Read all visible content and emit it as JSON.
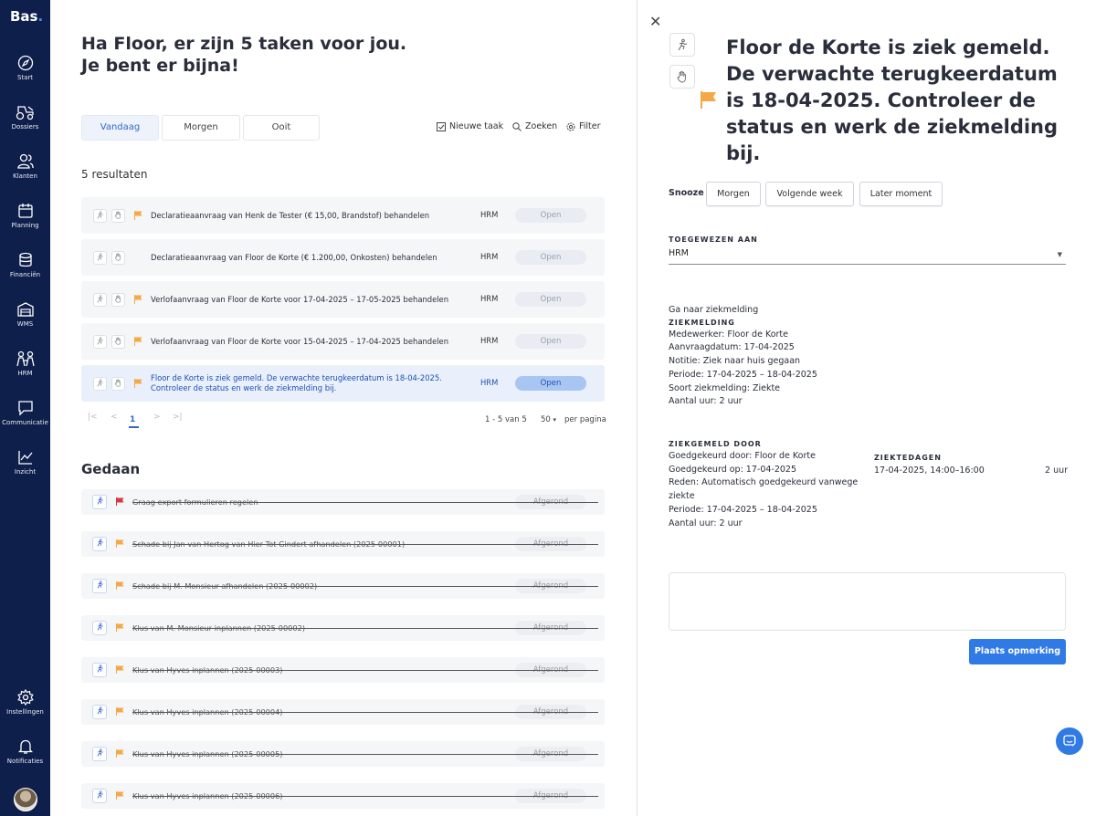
{
  "sidebar": {
    "logo": "Bas",
    "logo_dot": ".",
    "items": [
      {
        "label": "Start",
        "icon": "compass-icon"
      },
      {
        "label": "Dossiers",
        "icon": "tractor-icon"
      },
      {
        "label": "Klanten",
        "icon": "users-icon"
      },
      {
        "label": "Planning",
        "icon": "calendar-icon"
      },
      {
        "label": "Financiën",
        "icon": "coins-icon"
      },
      {
        "label": "WMS",
        "icon": "warehouse-icon"
      },
      {
        "label": "HRM",
        "icon": "people-icon"
      },
      {
        "label": "Communicatie",
        "icon": "chat-icon"
      },
      {
        "label": "Inzicht",
        "icon": "chart-icon"
      }
    ],
    "bottom": [
      {
        "label": "Instellingen",
        "icon": "gear-icon"
      },
      {
        "label": "Notificaties",
        "icon": "bell-icon"
      }
    ]
  },
  "main": {
    "greeting": "Ha Floor, er zijn 5 taken voor jou. Je bent er bijna!",
    "tabs": [
      "Vandaag",
      "Morgen",
      "Ooit"
    ],
    "tools": {
      "new_task": "Nieuwe taak",
      "search": "Zoeken",
      "filter": "Filter"
    },
    "results": "5 resultaten",
    "tasks": [
      {
        "text": "Declaratieaanvraag van Henk de Tester (€ 15,00, Brandstof) behandelen",
        "category": "HRM",
        "status": "Open",
        "flag": true
      },
      {
        "text": "Declaratieaanvraag van Floor de Korte (€ 1.200,00, Onkosten) behandelen",
        "category": "HRM",
        "status": "Open",
        "flag": false
      },
      {
        "text": "Verlofaanvraag van Floor de Korte voor 17-04-2025 – 17-05-2025 behandelen",
        "category": "HRM",
        "status": "Open",
        "flag": true
      },
      {
        "text": "Verlofaanvraag van Floor de Korte voor 15-04-2025 – 17-04-2025 behandelen",
        "category": "HRM",
        "status": "Open",
        "flag": true
      },
      {
        "text": "Floor de Korte is ziek gemeld. De verwachte terugkeerdatum is 18-04-2025. Controleer de status en werk de ziekmelding bij.",
        "category": "HRM",
        "status": "Open",
        "flag": true
      }
    ],
    "pagination": {
      "first": "|<",
      "prev": "<",
      "current": "1",
      "next": ">",
      "last": ">|",
      "range": "1 - 5 van 5",
      "per_page": "50",
      "per_page_label": "per pagina"
    },
    "done_title": "Gedaan",
    "done": [
      {
        "text": "Graag export formulieren regelen",
        "status": "Afgerond",
        "flag_color": "#d9363e"
      },
      {
        "text": "Schade bij Jan van Hertog van Hier Tot Gindert afhandelen (2025-00001)",
        "status": "Afgerond",
        "flag_color": "#f6a846"
      },
      {
        "text": "Schade bij M. Monsieur afhandelen (2025-00002)",
        "status": "Afgerond",
        "flag_color": "#f6a846"
      },
      {
        "text": "Klus van M. Monsieur inplannen (2025-00002)",
        "status": "Afgerond",
        "flag_color": "#f6a846"
      },
      {
        "text": "Klus van Hyves inplannen (2025-00003)",
        "status": "Afgerond",
        "flag_color": "#f6a846"
      },
      {
        "text": "Klus van Hyves inplannen (2025-00004)",
        "status": "Afgerond",
        "flag_color": "#f6a846"
      },
      {
        "text": "Klus van Hyves inplannen (2025-00005)",
        "status": "Afgerond",
        "flag_color": "#f6a846"
      },
      {
        "text": "Klus van Hyves inplannen (2025-00006)",
        "status": "Afgerond",
        "flag_color": "#f6a846"
      }
    ]
  },
  "panel": {
    "title": "Floor de Korte is ziek gemeld. De verwachte terugkeerdatum is 18-04-2025. Controleer de status en werk de ziekmelding bij.",
    "snooze_label": "Snooze",
    "snooze_options": [
      "Morgen",
      "Volgende week",
      "Later moment"
    ],
    "assigned_label": "TOEGEWEZEN AAN",
    "assigned_value": "HRM",
    "goto_link": "Ga naar ziekmelding",
    "sick_section": "ZIEKMELDING",
    "sick_lines": [
      "Medewerker: Floor de Korte",
      "Aanvraagdatum: 17-04-2025",
      "Notitie: Ziek naar huis gegaan",
      "Periode: 17-04-2025 – 18-04-2025",
      "Soort ziekmelding: Ziekte",
      "Aantal uur: 2 uur"
    ],
    "reported_section": "ZIEKGEMELD DOOR",
    "reported_lines": [
      "Goedgekeurd door: Floor de Korte",
      "Goedgekeurd op: 17-04-2025",
      "Reden: Automatisch goedgekeurd vanwege ziekte",
      "Periode: 17-04-2025 – 18-04-2025",
      "Aantal uur: 2 uur"
    ],
    "sickdays_label": "ZIEKTEDAGEN",
    "sickdays_value": "17-04-2025, 14:00–16:00",
    "sickdays_hours": "2 uur",
    "comment_placeholder": "",
    "post_button": "Plaats opmerking"
  },
  "colors": {
    "sidebar": "#0f1f4b",
    "accent": "#2f7ae5",
    "flag": "#f6a846",
    "flag_red": "#d9363e"
  }
}
